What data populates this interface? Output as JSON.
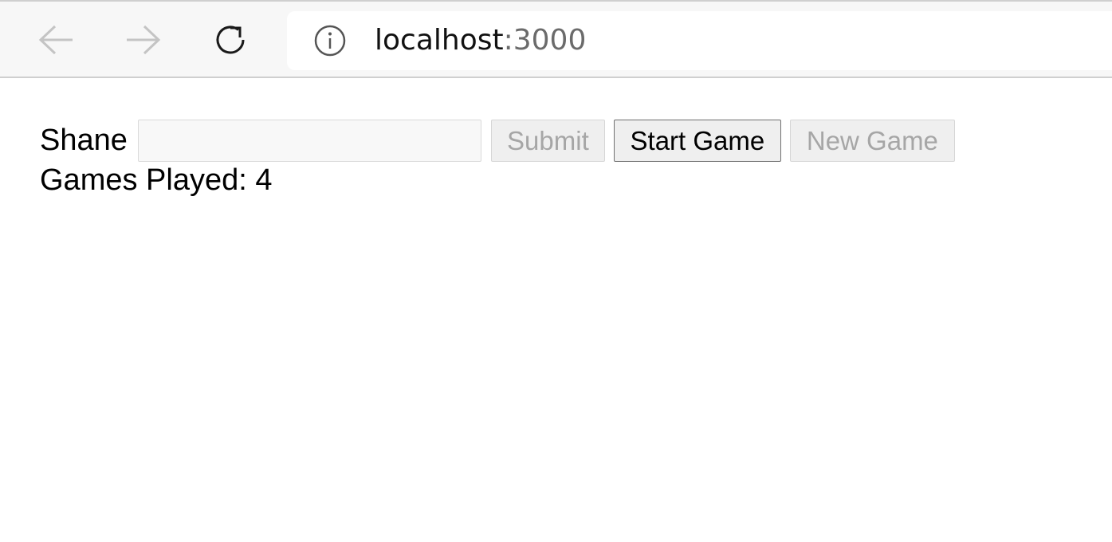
{
  "browser": {
    "url_host": "localhost",
    "url_port": ":3000",
    "icons": {
      "back": "arrow-left-icon",
      "forward": "arrow-right-icon",
      "reload": "reload-icon",
      "info": "info-icon"
    }
  },
  "form": {
    "name_label": "Shane",
    "name_input_value": "",
    "name_input_placeholder": "",
    "submit_label": "Submit",
    "start_game_label": "Start Game",
    "new_game_label": "New Game"
  },
  "stats": {
    "games_played_text": "Games Played: 4"
  },
  "colors": {
    "disabled_text": "#a6a6a6",
    "enabled_text": "#000000",
    "chrome_bg": "#f7f7f7"
  }
}
